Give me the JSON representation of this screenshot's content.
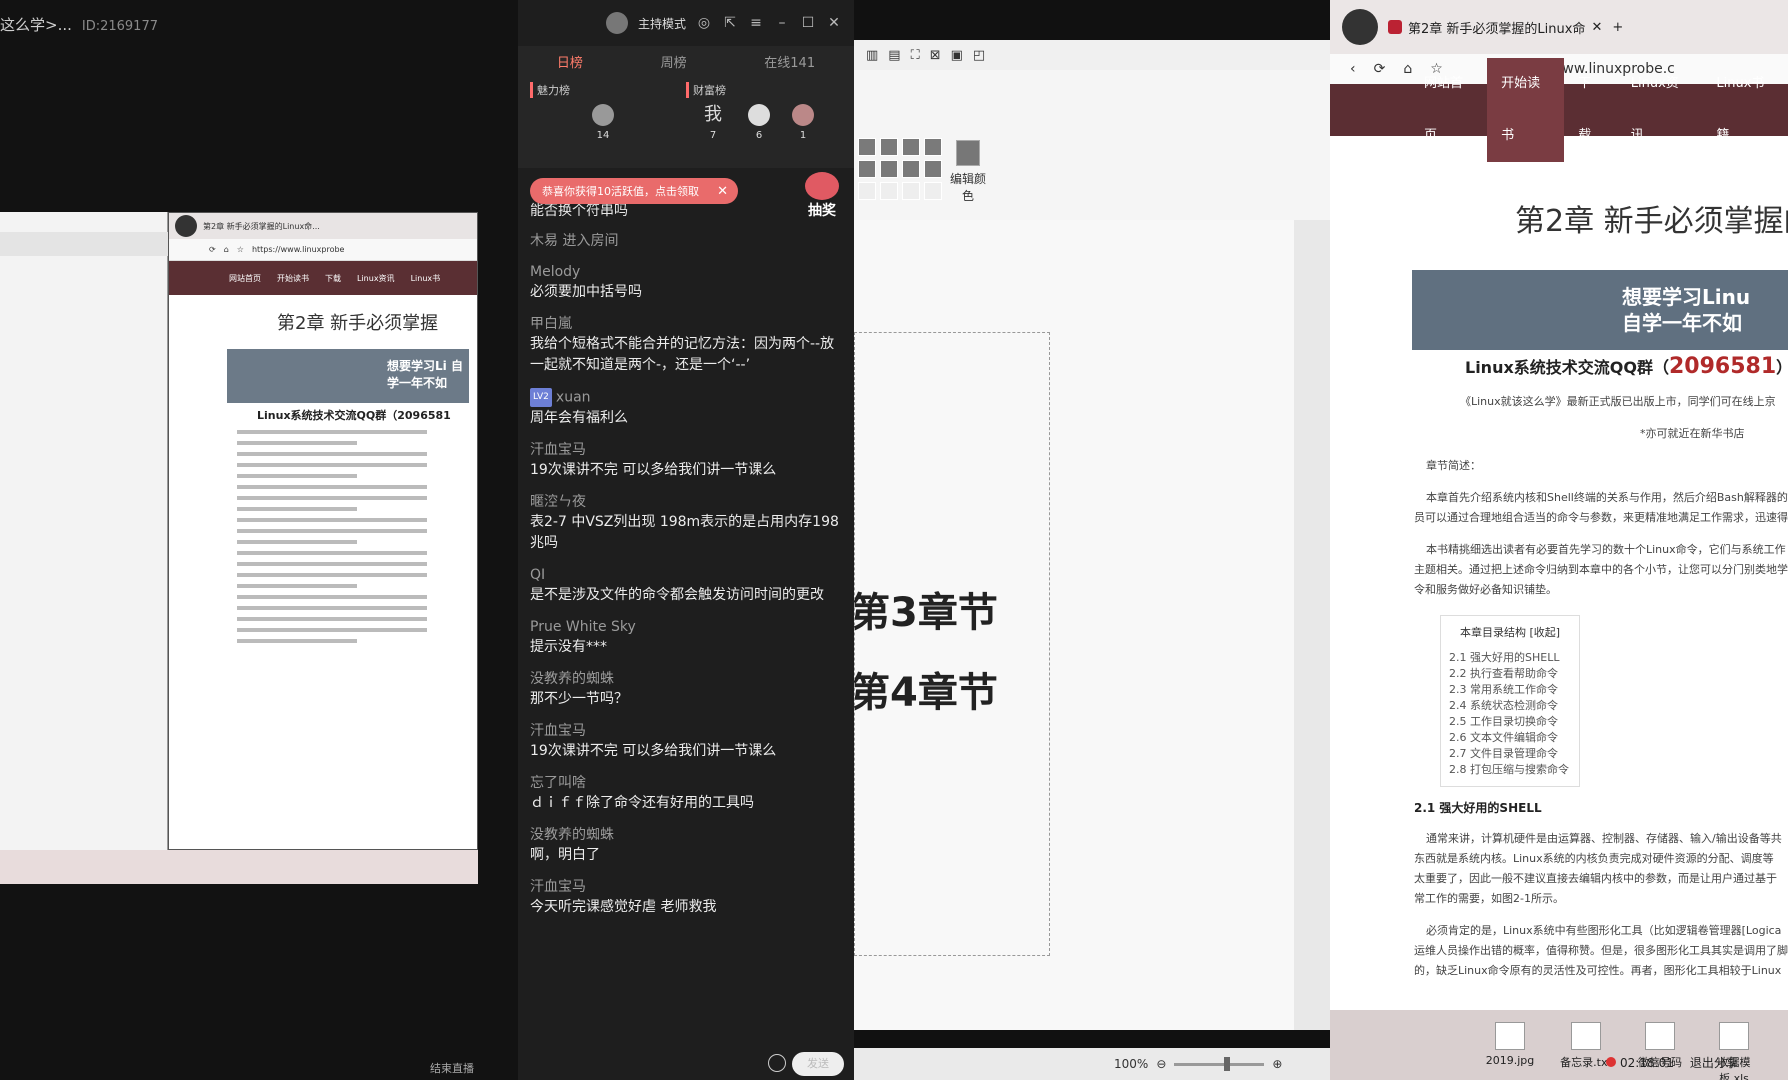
{
  "top_left": {
    "title": "这么学>...",
    "id": "ID:2169177"
  },
  "chat": {
    "host_mode": "主持模式",
    "tabs": [
      "日榜",
      "周榜",
      "在线141"
    ],
    "rank_labels": {
      "charm": "魅力榜",
      "wealth": "财富榜"
    },
    "charm_rank": [
      {
        "count": "14"
      }
    ],
    "wealth_rank": [
      {
        "name": "我",
        "count": "7"
      },
      {
        "count": "6"
      },
      {
        "count": "1"
      }
    ],
    "toast": "恭喜你获得10活跃值，点击领取",
    "lottery": "抽奖",
    "partial_line": "能否换个符串吗",
    "messages": [
      {
        "name": "木易 进入房间",
        "text": ""
      },
      {
        "name": "Melody",
        "text": "必须要加中括号吗"
      },
      {
        "name": "甲白嵐",
        "text": "我给个短格式不能合并的记忆方法：因为两个--放一起就不知道是两个-，还是一个‘--’"
      },
      {
        "name": "xuan",
        "level": "LV2",
        "text": "周年会有福利么"
      },
      {
        "name": "汗血宝马",
        "text": "19次课讲不完 可以多给我们讲一节课么"
      },
      {
        "name": "暱涳ㄣ夜",
        "text": "表2-7 中VSZ列出现 198m表示的是占用内存198兆吗"
      },
      {
        "name": "QI",
        "text": "是不是涉及文件的命令都会触发访问时间的更改"
      },
      {
        "name": "Prue White Sky",
        "text": "提示没有***"
      },
      {
        "name": "没教养的蜘蛛",
        "text": "那不少一节吗？"
      },
      {
        "name": "汗血宝马",
        "text": "19次课讲不完 可以多给我们讲一节课么"
      },
      {
        "name": "忘了叫啥",
        "text": "ｄｉｆｆ除了命令还有好用的工具吗"
      },
      {
        "name": "没教养的蜘蛛",
        "text": "啊，明白了"
      },
      {
        "name": "汗血宝马",
        "text": "今天听完课感觉好虐 老师救我"
      }
    ],
    "send_label": "发送",
    "end_share": "结束直播"
  },
  "doc": {
    "edit_color": "编辑颜色",
    "headings": [
      "第3章节",
      "第4章节"
    ],
    "zoom": "100%"
  },
  "small_browser": {
    "tab": "第2章 新手必须掌握的Linux命...",
    "url": "https://www.linuxprobe",
    "nav": [
      "网站首页",
      "开始读书",
      "下载",
      "Linux资讯",
      "Linux书"
    ],
    "heading": "第2章 新手必须掌握",
    "banner": "想要学习Li 自学一年不如",
    "qq": "Linux系统技术交流QQ群（2096581",
    "taskbar_items": [
      "2019.jpg",
      "备忘录.txt",
      "微信号码",
      "收据模板.xls"
    ],
    "time": "02:18:01",
    "exit": "退出分享"
  },
  "right_browser": {
    "tab": "第2章 新手必须掌握的Linux命",
    "url": "https://www.linuxprobe.c",
    "nav": [
      "网站首页",
      "开始读书",
      "下载",
      "Linux资讯",
      "Linux书籍"
    ],
    "heading": "第2章 新手必须掌握的",
    "banner_line1": "想要学习Linu",
    "banner_line2": "自学一年不如",
    "qq_prefix": "Linux系统技术交流QQ群（",
    "qq_number": "2096581",
    "qq_suffix": "）",
    "p1": "《Linux就该这么学》最新正式版已出版上市，同学们可在线上京",
    "p2": "*亦可就近在新华书店",
    "section_intro": "章节简述：",
    "p3": "本章首先介绍系统内核和Shell终端的关系与作用，然后介绍Bash解释器的",
    "p4": "员可以通过合理地组合适当的命令与参数，来更精准地满足工作需求，迅速得",
    "p5": "本书精挑细选出读者有必要首先学习的数十个Linux命令，它们与系统工作",
    "p6": "主题相关。通过把上述命令归纳到本章中的各个小节，让您可以分门别类地学",
    "p7": "令和服务做好必备知识铺垫。",
    "toc_title": "本章目录结构 [收起]",
    "toc": [
      "2.1 强大好用的SHELL",
      "2.2 执行查看帮助命令",
      "2.3 常用系统工作命令",
      "2.4 系统状态检测命令",
      "2.5 工作目录切换命令",
      "2.6 文本文件编辑命令",
      "2.7 文件目录管理命令",
      "2.8 打包压缩与搜索命令"
    ],
    "section": "2.1 强大好用的SHELL",
    "p8": "通常来讲，计算机硬件是由运算器、控制器、存储器、输入/输出设备等共",
    "p9": "东西就是系统内核。Linux系统的内核负责完成对硬件资源的分配、调度等",
    "p10": "太重要了，因此一般不建议直接去编辑内核中的参数，而是让用户通过基于",
    "p11": "常工作的需要，如图2-1所示。",
    "p12": "必须肯定的是，Linux系统中有些图形化工具（比如逻辑卷管理器[Logica",
    "p13": "运维人员操作出错的概率，值得称赞。但是，很多图形化工具其实是调用了脚",
    "p14": "的，缺乏Linux命令原有的灵活性及可控性。再者，图形化工具相较于Linux",
    "taskbar_items": [
      "2019.jpg",
      "备忘录.txt",
      "微信号码",
      "收据模板.xls"
    ],
    "time": "02:18:01",
    "exit": "退出分享"
  }
}
